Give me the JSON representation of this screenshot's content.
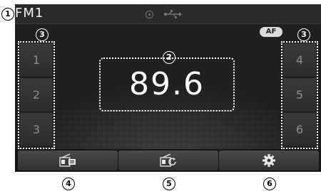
{
  "status": {
    "band": "FM1",
    "af_label": "AF"
  },
  "presets_left": [
    {
      "label": "1"
    },
    {
      "label": "2"
    },
    {
      "label": "3"
    }
  ],
  "presets_right": [
    {
      "label": "4"
    },
    {
      "label": "5"
    },
    {
      "label": "6"
    }
  ],
  "frequency": "89.6",
  "bottom_buttons": [
    {
      "icon": "radio-list-icon"
    },
    {
      "icon": "radio-scan-icon"
    },
    {
      "icon": "gear-icon"
    }
  ],
  "callouts": {
    "c1": "1",
    "c2": "2",
    "c3": "3",
    "c4": "4",
    "c5": "5",
    "c6": "6"
  }
}
